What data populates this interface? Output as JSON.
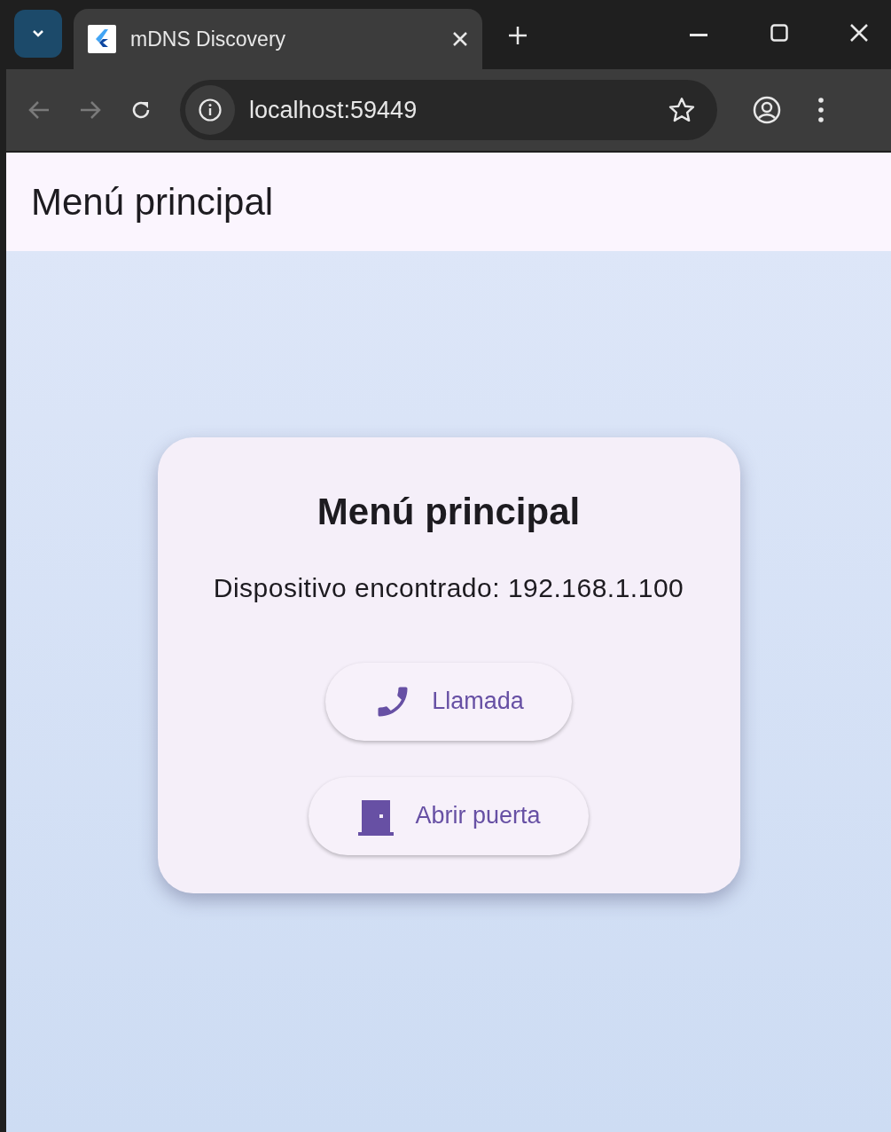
{
  "browser": {
    "tab": {
      "title": "mDNS Discovery"
    },
    "address": "localhost:59449"
  },
  "app_bar": {
    "title": "Menú principal"
  },
  "card": {
    "title": "Menú principal",
    "message": "Dispositivo encontrado: 192.168.1.100",
    "buttons": [
      {
        "kind": "phone",
        "label": "Llamada"
      },
      {
        "kind": "door",
        "label": "Abrir puerta"
      }
    ]
  }
}
